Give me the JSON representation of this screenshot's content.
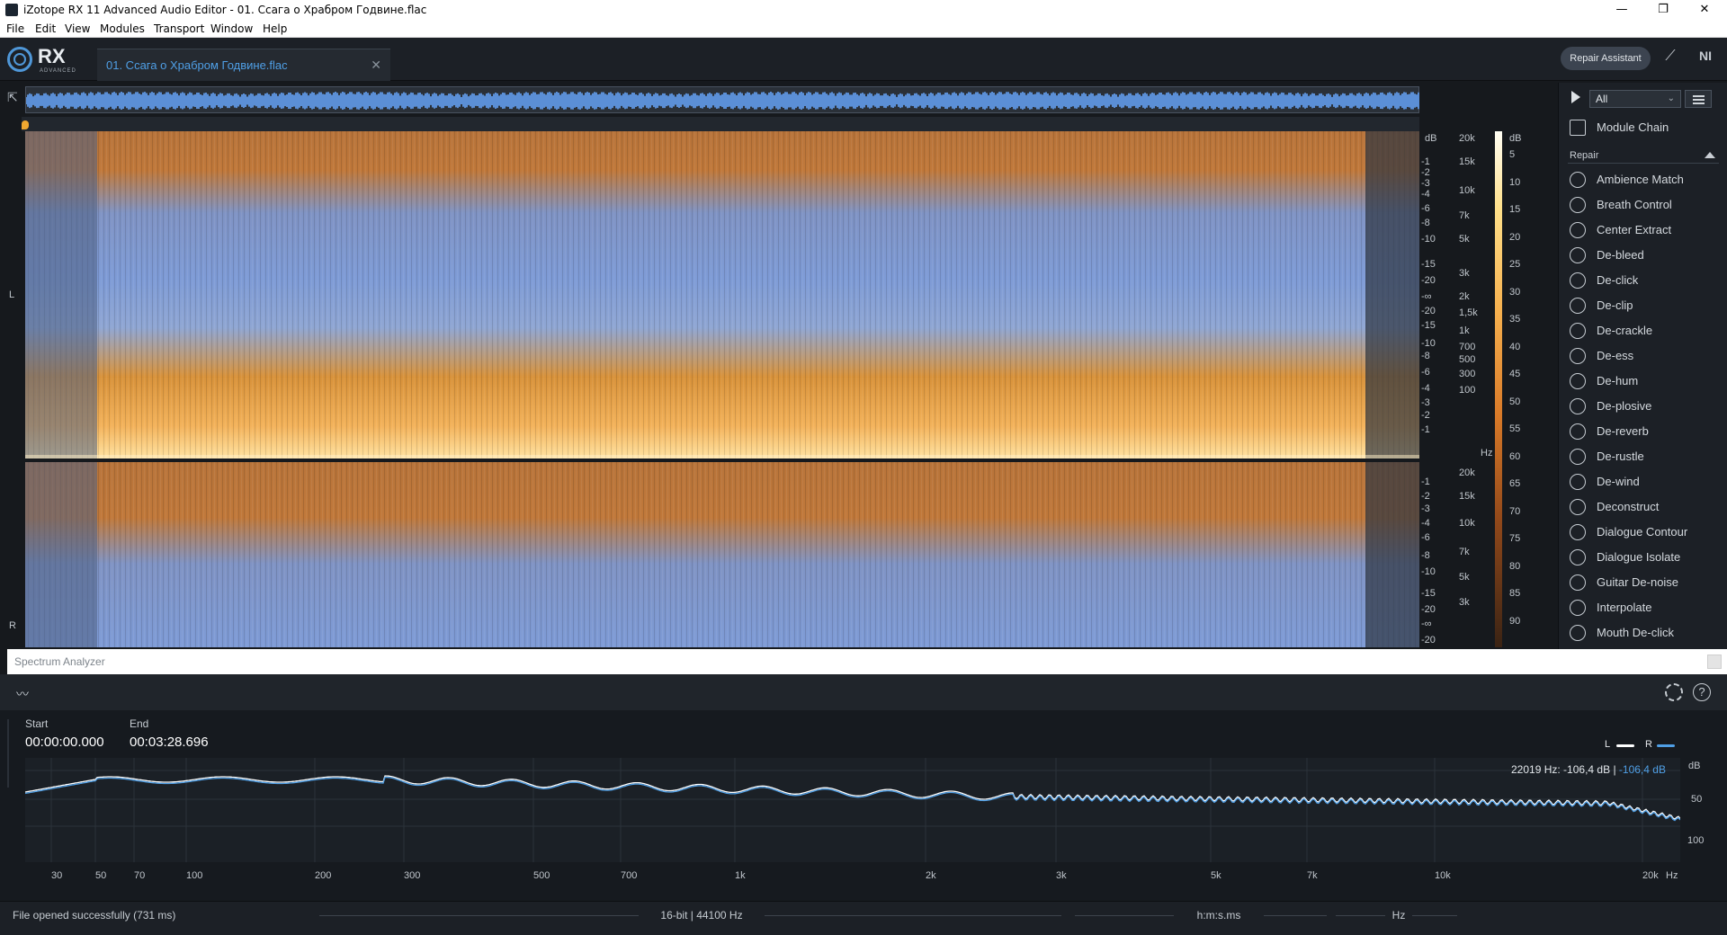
{
  "window": {
    "title": "iZotope RX 11 Advanced Audio Editor - 01. Ссага о Храбром Годвине.flac",
    "controls": [
      "—",
      "❐",
      "✕"
    ]
  },
  "menu": [
    "File",
    "Edit",
    "View",
    "Modules",
    "Transport",
    "Window",
    "Help"
  ],
  "header": {
    "logo_text": "RX",
    "logo_sub": "ADVANCED",
    "file_tab": "01. Ссага о Храбром Годвине.flac",
    "file_tab_close": "✕",
    "repair_assistant": "Repair Assistant",
    "ni_logo": "NI"
  },
  "spectrogram": {
    "channels": [
      "L",
      "R"
    ],
    "db_label": "dB",
    "hz_label": "Hz",
    "db_ticks_top": [
      "-1",
      "-2",
      "-3",
      "-4",
      "-6",
      "-8",
      "-10",
      "-15",
      "-20",
      "-∞",
      "-20",
      "-15",
      "-10",
      "-8",
      "-6",
      "-4",
      "-3",
      "-2",
      "-1"
    ],
    "hz_ticks_top": [
      "20k",
      "15k",
      "10k",
      "7k",
      "5k",
      "3k",
      "2k",
      "1,5k",
      "1k",
      "700",
      "500",
      "300",
      "100"
    ],
    "db_ticks_bottom": [
      "-1",
      "-2",
      "-3",
      "-4",
      "-6",
      "-8",
      "-10",
      "-15",
      "-20",
      "-∞",
      "-20"
    ],
    "hz_ticks_bottom": [
      "20k",
      "15k",
      "10k",
      "7k",
      "5k",
      "3k"
    ],
    "colorbar_label": "dB",
    "colorbar_ticks": [
      "5",
      "10",
      "15",
      "20",
      "25",
      "30",
      "35",
      "40",
      "45",
      "50",
      "55",
      "60",
      "65",
      "70",
      "75",
      "80",
      "85",
      "90"
    ]
  },
  "module_panel": {
    "filter": "All",
    "module_chain": "Module Chain",
    "section": "Repair",
    "modules": [
      "Ambience Match",
      "Breath Control",
      "Center Extract",
      "De-bleed",
      "De-click",
      "De-clip",
      "De-crackle",
      "De-ess",
      "De-hum",
      "De-plosive",
      "De-reverb",
      "De-rustle",
      "De-wind",
      "Deconstruct",
      "Dialogue Contour",
      "Dialogue Isolate",
      "Guitar De-noise",
      "Interpolate",
      "Mouth De-click"
    ]
  },
  "spectrum_analyzer": {
    "title": "Spectrum Analyzer",
    "start_label": "Start",
    "start_value": "00:00:00.000",
    "end_label": "End",
    "end_value": "00:03:28.696",
    "legend_L": "L",
    "legend_R": "R",
    "readout_freq": "22019 Hz:",
    "readout_L": "-106,4 dB",
    "readout_sep": "|",
    "readout_R": "-106,4 dB",
    "y_unit": "dB",
    "y_ticks": [
      "50",
      "100"
    ],
    "x_unit": "Hz",
    "x_ticks": [
      "30",
      "50",
      "70",
      "100",
      "200",
      "300",
      "500",
      "700",
      "1k",
      "2k",
      "3k",
      "5k",
      "7k",
      "10k",
      "20k"
    ],
    "colors": {
      "L": "#ffffff",
      "R": "#4f9fe6"
    }
  },
  "status": {
    "message": "File opened successfully (731 ms)",
    "format": "16-bit | 44100 Hz",
    "time_format": "h:m:s.ms",
    "freq_unit": "Hz"
  }
}
